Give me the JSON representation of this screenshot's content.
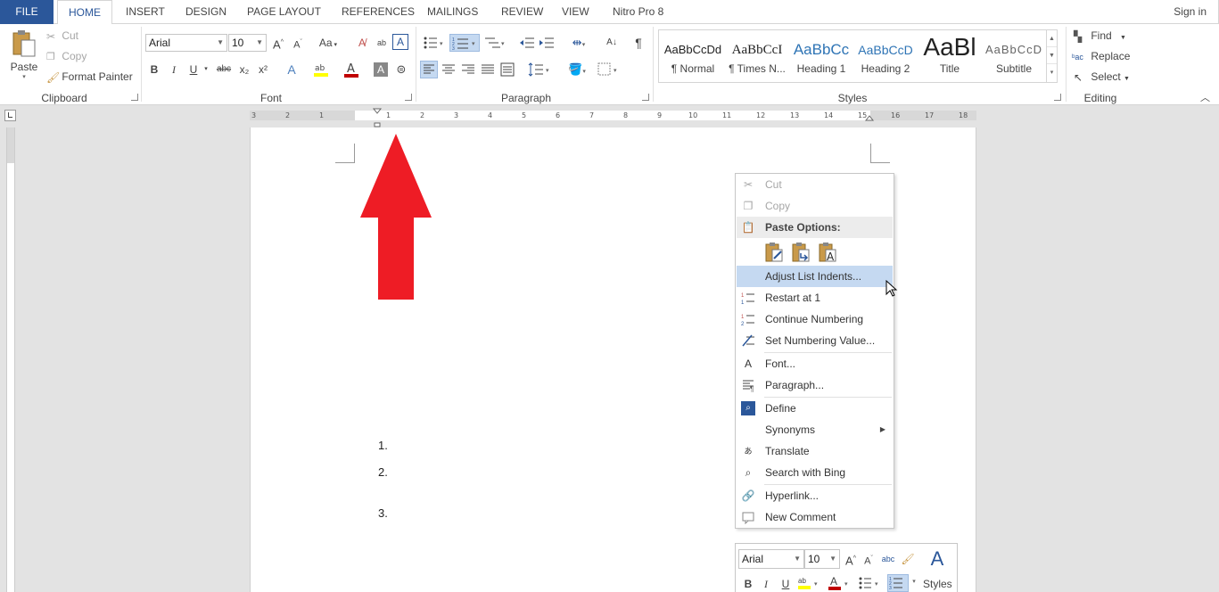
{
  "tabs": {
    "file": "FILE",
    "items": [
      "HOME",
      "INSERT",
      "DESIGN",
      "PAGE LAYOUT",
      "REFERENCES",
      "MAILINGS",
      "REVIEW",
      "VIEW",
      "Nitro Pro 8"
    ],
    "sign_in": "Sign in"
  },
  "clipboard": {
    "paste": "Paste",
    "cut": "Cut",
    "copy": "Copy",
    "format_painter": "Format Painter",
    "label": "Clipboard"
  },
  "font": {
    "name": "Arial",
    "size": "10",
    "bold": "B",
    "italic": "I",
    "underline": "U",
    "strike": "abc",
    "subscript": "x₂",
    "superscript": "x²",
    "change_case": "Aa",
    "label": "Font"
  },
  "paragraph": {
    "label": "Paragraph",
    "pilcrow": "¶"
  },
  "styles": {
    "items": [
      {
        "preview": "AaBbCcDd",
        "name": "¶ Normal"
      },
      {
        "preview": "AaBbCcI",
        "name": "¶ Times N..."
      },
      {
        "preview": "AaBbCc",
        "name": "Heading 1"
      },
      {
        "preview": "AaBbCcD",
        "name": "Heading 2"
      },
      {
        "preview": "AaBl",
        "name": "Title"
      },
      {
        "preview": "AaBbCcD",
        "name": "Subtitle"
      }
    ],
    "label": "Styles"
  },
  "editing": {
    "find": "Find",
    "replace": "Replace",
    "select": "Select",
    "label": "Editing"
  },
  "ruler": {
    "ticks": [
      "3",
      "2",
      "1",
      "1",
      "2",
      "3",
      "4",
      "5",
      "6",
      "7",
      "8",
      "9",
      "10",
      "11",
      "12",
      "13",
      "14",
      "15",
      "16",
      "17",
      "18"
    ]
  },
  "document": {
    "list_numbers": [
      "1.",
      "2.",
      "3."
    ]
  },
  "context_menu": {
    "cut": "Cut",
    "copy": "Copy",
    "paste_options": "Paste Options:",
    "adjust_list_indents": "Adjust List Indents...",
    "restart_at_1": "Restart at 1",
    "continue_numbering": "Continue Numbering",
    "set_numbering_value": "Set Numbering Value...",
    "font": "Font...",
    "paragraph": "Paragraph...",
    "define": "Define",
    "synonyms": "Synonyms",
    "translate": "Translate",
    "search_with_bing": "Search with Bing",
    "hyperlink": "Hyperlink...",
    "new_comment": "New Comment"
  },
  "mini_toolbar": {
    "font": "Arial",
    "size": "10",
    "styles": "Styles",
    "bold": "B",
    "italic": "I",
    "underline": "U"
  },
  "colors": {
    "file_tab": "#2b579a",
    "accent_blue": "#2b579a",
    "arrow_red": "#ee1c25",
    "highlight": "#c5d9f1",
    "font_color_red": "#c00000",
    "highlight_yellow": "#ffff00"
  }
}
